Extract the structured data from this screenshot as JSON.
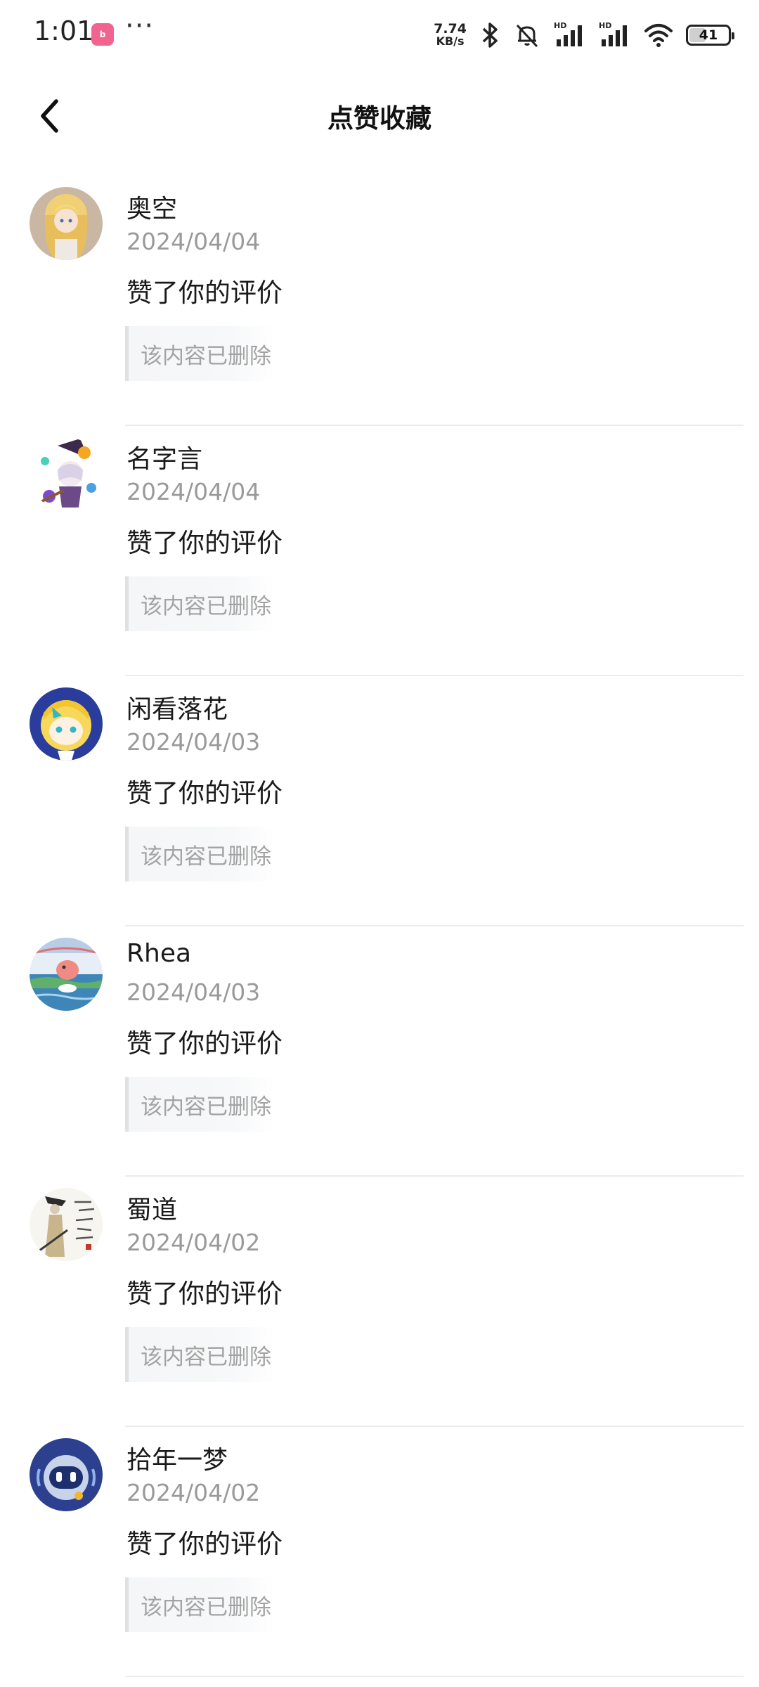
{
  "status_bar": {
    "time": "1:01",
    "app_badge": "bilibili",
    "dots": "···",
    "net_speed_value": "7.74",
    "net_speed_unit": "KB/s",
    "hd_label": "HD",
    "battery_level": "41"
  },
  "nav": {
    "title": "点赞收藏"
  },
  "items": [
    {
      "name": "奥空",
      "date": "2024/04/04",
      "action": "赞了你的评价",
      "quote": "该内容已删除",
      "avatar": "anime-girl-blonde-avatar"
    },
    {
      "name": "名字言",
      "date": "2024/04/04",
      "action": "赞了你的评价",
      "quote": "该内容已删除",
      "avatar": "witch-girl-avatar"
    },
    {
      "name": "闲看落花",
      "date": "2024/04/03",
      "action": "赞了你的评价",
      "quote": "该内容已删除",
      "avatar": "chibi-girl-blue-avatar"
    },
    {
      "name": "Rhea",
      "date": "2024/04/03",
      "action": "赞了你的评价",
      "quote": "该内容已删除",
      "avatar": "pink-creature-water-avatar"
    },
    {
      "name": "蜀道",
      "date": "2024/04/02",
      "action": "赞了你的评价",
      "quote": "该内容已删除",
      "avatar": "ink-figure-calligraphy-avatar"
    },
    {
      "name": "拾年一梦",
      "date": "2024/04/02",
      "action": "赞了你的评价",
      "quote": "该内容已删除",
      "avatar": "robot-blue-avatar"
    }
  ],
  "colors": {
    "title_text": "#111111",
    "date_text": "#9a9a9a",
    "quote_text": "#a3a3a3",
    "quote_bar": "#dfe1e4",
    "divider": "#ececec",
    "app_badge": "#f1648f"
  }
}
